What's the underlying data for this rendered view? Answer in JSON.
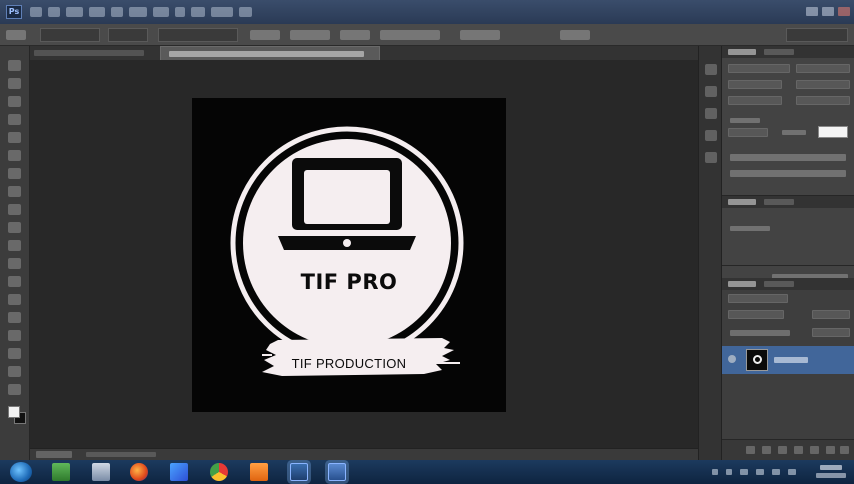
{
  "app": {
    "name": "Adobe Photoshop",
    "icon": "photoshop-icon",
    "accent_color": "#41669a"
  },
  "canvas": {
    "background_color": "#050505",
    "logo": {
      "badge_icon": "laptop-icon",
      "badge_color": "#f5eef0",
      "brand_name": "TIF PRO",
      "tagline": "TIF PRODUCTION"
    }
  },
  "colors": {
    "foreground": "#f2f2f2",
    "background": "#111111"
  },
  "taskbar": {
    "start_icon": "windows-start-icon",
    "apps": [
      "windows-explorer-icon",
      "file-manager-icon",
      "firefox-icon",
      "media-player-icon",
      "chrome-icon",
      "orange-app-icon",
      "photoshop-taskbar-icon",
      "presentation-app-icon"
    ]
  }
}
